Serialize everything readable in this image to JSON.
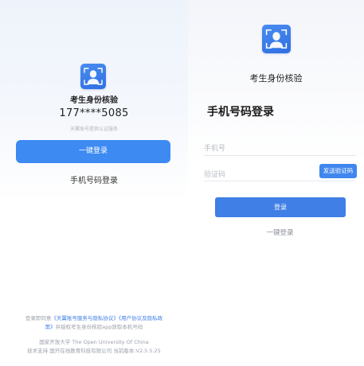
{
  "left_panel": {
    "app_name": "考生身份核验",
    "masked_phone": "177****5085",
    "carrier_notice": "天翼账号提供认证服务",
    "one_click_login_label": "一键登录",
    "phone_login_link": "手机号码登录",
    "agreement": {
      "prefix": "登录即同意",
      "terms_link": "《天翼账号服务与隐私协议》",
      "user_agreement_link_part1": "《用户协议及隐私政",
      "user_agreement_link_part2": "策》",
      "suffix": "并授权考生身份核验app获取本机号码"
    },
    "footer_org": "国家开放大学 The Open University Of China",
    "footer_support": "技术支持 国开在线教育科技有限公司 当前版本:V2.5.5.25"
  },
  "right_panel": {
    "app_name": "考生身份核验",
    "heading": "手机号码登录",
    "phone_placeholder": "手机号",
    "code_placeholder": "验证码",
    "send_code_label": "发送验证码",
    "login_label": "登录",
    "one_click_link": "一键登录"
  },
  "colors": {
    "accent": "#3c8af2",
    "link": "#3f7ee6",
    "logo": "#3a7ee9"
  },
  "icons": {
    "logo": "face-scan-icon"
  }
}
